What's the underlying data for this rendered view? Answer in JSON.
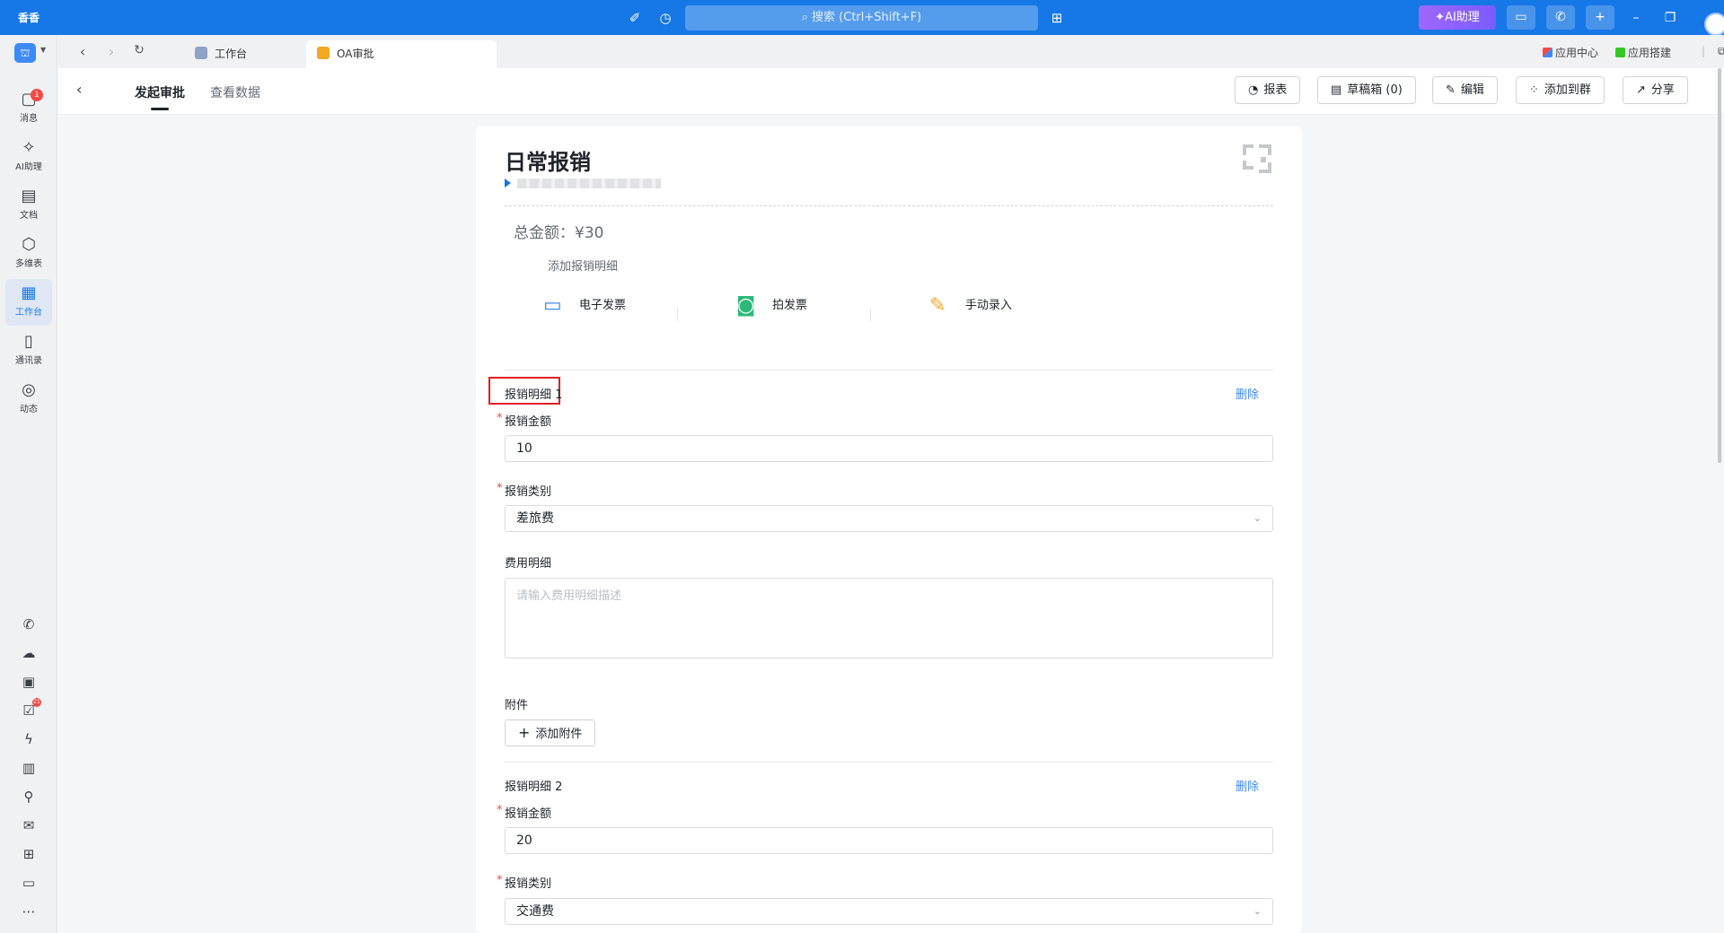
{
  "titlebar": {
    "app_name": "香香",
    "search_placeholder": "搜索 (Ctrl+Shift+F)",
    "ai_button": "AI助理"
  },
  "rail": {
    "items": [
      {
        "label": "消息",
        "badge": "1"
      },
      {
        "label": "AI助理"
      },
      {
        "label": "文档"
      },
      {
        "label": "多维表"
      },
      {
        "label": "工作台"
      },
      {
        "label": "通讯录"
      },
      {
        "label": "动态"
      }
    ],
    "tool_badge": "21"
  },
  "tabs": {
    "items": [
      {
        "label": "工作台"
      },
      {
        "label": "OA审批"
      }
    ],
    "right_links": [
      "应用中心",
      "应用搭建"
    ]
  },
  "page_header": {
    "tabs": [
      "发起审批",
      "查看数据"
    ],
    "buttons": [
      "报表",
      "草稿箱 (0)",
      "编辑",
      "添加到群",
      "分享"
    ]
  },
  "form": {
    "title": "日常报销",
    "total": "总金额：¥30",
    "add_detail": "添加报销明细",
    "entry_methods": [
      "电子发票",
      "拍发票",
      "手动录入"
    ],
    "details": [
      {
        "title": "报销明细 1",
        "delete": "删除",
        "amount_label": "报销金额",
        "amount": "10",
        "category_label": "报销类别",
        "category": "差旅费",
        "desc_label": "费用明细",
        "desc_placeholder": "请输入费用明细描述",
        "attach_label": "附件",
        "attach_button": "添加附件"
      },
      {
        "title": "报销明细 2",
        "delete": "删除",
        "amount_label": "报销金额",
        "amount": "20",
        "category_label": "报销类别",
        "category": "交通费"
      }
    ]
  },
  "colors": {
    "titlebar": "#1677e6",
    "accent": "#3d8af7",
    "required": "#f54a45",
    "highlight_box": "#e02020"
  }
}
